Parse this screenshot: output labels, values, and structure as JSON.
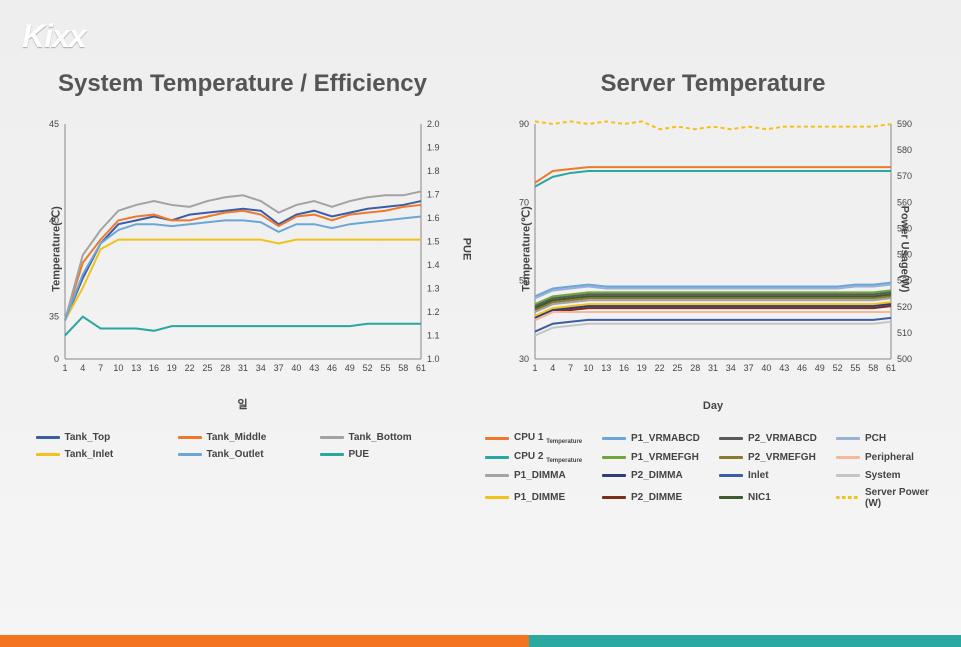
{
  "logo": "Kixx",
  "chart_data": [
    {
      "type": "line",
      "title": "System Temperature / Efficiency",
      "xlabel": "일",
      "ylabel_left": "Temperature(℃)",
      "ylabel_right": "PUE",
      "x": [
        1,
        4,
        7,
        10,
        13,
        16,
        19,
        22,
        25,
        28,
        31,
        34,
        37,
        40,
        43,
        46,
        49,
        52,
        55,
        58,
        61
      ],
      "y_left_scale": {
        "min": 0,
        "max": 45,
        "ticks": [
          0,
          35,
          40,
          45
        ],
        "is_broken": true
      },
      "y_right_scale": {
        "min": 1.0,
        "max": 2.0,
        "ticks": [
          1.0,
          1.1,
          1.2,
          1.3,
          1.4,
          1.5,
          1.6,
          1.7,
          1.8,
          1.9,
          2.0
        ]
      },
      "series": [
        {
          "name": "Tank_Top",
          "color": "#3b5ca8",
          "axis": "left",
          "values": [
            32.0,
            37.0,
            38.8,
            39.8,
            40.0,
            40.2,
            40.0,
            40.3,
            40.4,
            40.5,
            40.6,
            40.5,
            39.8,
            40.3,
            40.5,
            40.2,
            40.4,
            40.6,
            40.7,
            40.8,
            41.0
          ]
        },
        {
          "name": "Tank_Middle",
          "color": "#f0782d",
          "axis": "left",
          "values": [
            32.0,
            37.8,
            39.0,
            40.0,
            40.2,
            40.3,
            40.0,
            40.0,
            40.2,
            40.4,
            40.5,
            40.3,
            39.7,
            40.2,
            40.3,
            40.0,
            40.3,
            40.4,
            40.5,
            40.7,
            40.8
          ]
        },
        {
          "name": "Tank_Bottom",
          "color": "#a3a3a3",
          "axis": "left",
          "values": [
            32.0,
            38.2,
            39.5,
            40.5,
            40.8,
            41.0,
            40.8,
            40.7,
            41.0,
            41.2,
            41.3,
            41.0,
            40.4,
            40.8,
            41.0,
            40.7,
            41.0,
            41.2,
            41.3,
            41.3,
            41.5
          ]
        },
        {
          "name": "Tank_Inlet",
          "color": "#f2c11a",
          "axis": "left",
          "values": [
            32.0,
            36.5,
            38.5,
            39.0,
            39.0,
            39.0,
            39.0,
            39.0,
            39.0,
            39.0,
            39.0,
            39.0,
            38.8,
            39.0,
            39.0,
            39.0,
            39.0,
            39.0,
            39.0,
            39.0,
            39.0
          ]
        },
        {
          "name": "Tank_Outlet",
          "color": "#6aa7d8",
          "axis": "left",
          "values": [
            32.0,
            37.2,
            38.8,
            39.5,
            39.8,
            39.8,
            39.7,
            39.8,
            39.9,
            40.0,
            40.0,
            39.9,
            39.4,
            39.8,
            39.8,
            39.6,
            39.8,
            39.9,
            40.0,
            40.1,
            40.2
          ]
        },
        {
          "name": "PUE",
          "color": "#2aa79f",
          "axis": "right",
          "values": [
            1.1,
            1.18,
            1.13,
            1.13,
            1.13,
            1.12,
            1.14,
            1.14,
            1.14,
            1.14,
            1.14,
            1.14,
            1.14,
            1.14,
            1.14,
            1.14,
            1.14,
            1.15,
            1.15,
            1.15,
            1.15
          ]
        }
      ]
    },
    {
      "type": "line",
      "title": "Server Temperature",
      "xlabel": "Day",
      "ylabel_left": "Temperature(℃)",
      "ylabel_right": "Power Usage(W)",
      "x": [
        1,
        4,
        7,
        10,
        13,
        16,
        19,
        22,
        25,
        28,
        31,
        34,
        37,
        40,
        43,
        46,
        49,
        52,
        55,
        58,
        61
      ],
      "y_left_scale": {
        "min": 30,
        "max": 90,
        "ticks": [
          30,
          50,
          70,
          90
        ]
      },
      "y_right_scale": {
        "min": 500,
        "max": 590,
        "ticks": [
          500,
          510,
          520,
          530,
          540,
          550,
          560,
          570,
          580,
          590
        ]
      },
      "series": [
        {
          "name": "CPU 1 Temperature",
          "color": "#f0782d",
          "axis": "left",
          "values": [
            75.0,
            78.0,
            78.5,
            79.0,
            79.0,
            79.0,
            79.0,
            79.0,
            79.0,
            79.0,
            79.0,
            79.0,
            79.0,
            79.0,
            79.0,
            79.0,
            79.0,
            79.0,
            79.0,
            79.0,
            79.0
          ]
        },
        {
          "name": "CPU 2 Temperature",
          "color": "#2aa79f",
          "axis": "left",
          "values": [
            74.0,
            76.5,
            77.5,
            78.0,
            78.0,
            78.0,
            78.0,
            78.0,
            78.0,
            78.0,
            78.0,
            78.0,
            78.0,
            78.0,
            78.0,
            78.0,
            78.0,
            78.0,
            78.0,
            78.0,
            78.0
          ]
        },
        {
          "name": "P1_VRMABCD",
          "color": "#6aa7d8",
          "axis": "left",
          "values": [
            46.0,
            48.0,
            48.5,
            49.0,
            48.5,
            48.5,
            48.5,
            48.5,
            48.5,
            48.5,
            48.5,
            48.5,
            48.5,
            48.5,
            48.5,
            48.5,
            48.5,
            48.5,
            49.0,
            49.0,
            49.5
          ]
        },
        {
          "name": "P1_VRMEFGH",
          "color": "#6ea83b",
          "axis": "left",
          "values": [
            44.0,
            46.0,
            46.5,
            47.0,
            47.0,
            47.0,
            47.0,
            47.0,
            47.0,
            47.0,
            47.0,
            47.0,
            47.0,
            47.0,
            47.0,
            47.0,
            47.0,
            47.0,
            47.0,
            47.0,
            47.5
          ]
        },
        {
          "name": "P2_VRMABCD",
          "color": "#5a5a5a",
          "axis": "left",
          "values": [
            43.5,
            45.5,
            46.0,
            46.5,
            46.5,
            46.5,
            46.5,
            46.5,
            46.5,
            46.5,
            46.5,
            46.5,
            46.5,
            46.5,
            46.5,
            46.5,
            46.5,
            46.5,
            46.5,
            46.5,
            47.0
          ]
        },
        {
          "name": "P2_VRMEFGH",
          "color": "#8a7a2d",
          "axis": "left",
          "values": [
            42.5,
            44.5,
            45.0,
            45.5,
            45.5,
            45.5,
            45.5,
            45.5,
            45.5,
            45.5,
            45.5,
            45.5,
            45.5,
            45.5,
            45.5,
            45.5,
            45.5,
            45.5,
            45.5,
            45.5,
            46.0
          ]
        },
        {
          "name": "P1_DIMMA",
          "color": "#a3a3a3",
          "axis": "left",
          "values": [
            42.0,
            44.0,
            44.5,
            45.0,
            45.0,
            45.0,
            45.0,
            45.0,
            45.0,
            45.0,
            45.0,
            45.0,
            45.0,
            45.0,
            45.0,
            45.0,
            45.0,
            45.0,
            45.0,
            45.0,
            45.5
          ]
        },
        {
          "name": "P1_DIMME",
          "color": "#f2c11a",
          "axis": "left",
          "values": [
            41.0,
            43.0,
            43.5,
            44.0,
            44.0,
            44.0,
            44.0,
            44.0,
            44.0,
            44.0,
            44.0,
            44.0,
            44.0,
            44.0,
            44.0,
            44.0,
            44.0,
            44.0,
            44.0,
            44.0,
            44.5
          ]
        },
        {
          "name": "P2_DIMMA",
          "color": "#2e3d7a",
          "axis": "left",
          "values": [
            40.5,
            42.5,
            43.0,
            43.5,
            43.5,
            43.5,
            43.5,
            43.5,
            43.5,
            43.5,
            43.5,
            43.5,
            43.5,
            43.5,
            43.5,
            43.5,
            43.5,
            43.5,
            43.5,
            43.5,
            44.0
          ]
        },
        {
          "name": "P2_DIMME",
          "color": "#7a2d1d",
          "axis": "left",
          "values": [
            40.0,
            42.0,
            42.5,
            43.0,
            43.0,
            43.0,
            43.0,
            43.0,
            43.0,
            43.0,
            43.0,
            43.0,
            43.0,
            43.0,
            43.0,
            43.0,
            43.0,
            43.0,
            43.0,
            43.0,
            43.5
          ]
        },
        {
          "name": "PCH",
          "color": "#9bb0d8",
          "axis": "left",
          "values": [
            45.5,
            47.5,
            48.0,
            48.5,
            48.0,
            48.0,
            48.0,
            48.0,
            48.0,
            48.0,
            48.0,
            48.0,
            48.0,
            48.0,
            48.0,
            48.0,
            48.0,
            48.0,
            48.5,
            48.5,
            49.0
          ]
        },
        {
          "name": "Peripheral",
          "color": "#f5b99a",
          "axis": "left",
          "values": [
            40.0,
            42.0,
            42.0,
            42.0,
            42.0,
            42.0,
            42.0,
            42.0,
            42.0,
            42.0,
            42.0,
            42.0,
            42.0,
            42.0,
            42.0,
            42.0,
            42.0,
            42.0,
            42.0,
            42.0,
            42.0
          ]
        },
        {
          "name": "Inlet",
          "color": "#3b5ca8",
          "axis": "left",
          "values": [
            37.0,
            39.0,
            39.5,
            40.0,
            40.0,
            40.0,
            40.0,
            40.0,
            40.0,
            40.0,
            40.0,
            40.0,
            40.0,
            40.0,
            40.0,
            40.0,
            40.0,
            40.0,
            40.0,
            40.0,
            40.5
          ]
        },
        {
          "name": "NIC1",
          "color": "#3f5a2d",
          "axis": "left",
          "values": [
            43.0,
            45.0,
            45.5,
            46.0,
            46.0,
            46.0,
            46.0,
            46.0,
            46.0,
            46.0,
            46.0,
            46.0,
            46.0,
            46.0,
            46.0,
            46.0,
            46.0,
            46.0,
            46.0,
            46.0,
            46.5
          ]
        },
        {
          "name": "System",
          "color": "#c5c5c5",
          "axis": "left",
          "values": [
            36.0,
            38.0,
            38.5,
            39.0,
            39.0,
            39.0,
            39.0,
            39.0,
            39.0,
            39.0,
            39.0,
            39.0,
            39.0,
            39.0,
            39.0,
            39.0,
            39.0,
            39.0,
            39.0,
            39.0,
            39.5
          ]
        },
        {
          "name": "Server Power (W)",
          "color": "#f2c11a",
          "axis": "right",
          "dashed": true,
          "values": [
            591,
            590,
            591,
            590,
            591,
            590,
            591,
            588,
            589,
            588,
            589,
            588,
            589,
            588,
            589,
            589,
            589,
            589,
            589,
            589,
            590
          ]
        }
      ]
    }
  ],
  "legend1": [
    {
      "key": "Tank_Top",
      "color": "#3b5ca8"
    },
    {
      "key": "Tank_Middle",
      "color": "#f0782d"
    },
    {
      "key": "Tank_Bottom",
      "color": "#a3a3a3"
    },
    {
      "key": "Tank_Inlet",
      "color": "#f2c11a"
    },
    {
      "key": "Tank_Outlet",
      "color": "#6aa7d8"
    },
    {
      "key": "PUE",
      "color": "#2aa79f"
    }
  ],
  "legend2": [
    {
      "key": "CPU 1 Temperature",
      "color": "#f0782d"
    },
    {
      "key": "P1_VRMABCD",
      "color": "#6aa7d8"
    },
    {
      "key": "P2_VRMABCD",
      "color": "#5a5a5a"
    },
    {
      "key": "PCH",
      "color": "#9bb0d8"
    },
    {
      "key": "CPU 2 Temperature",
      "color": "#2aa79f"
    },
    {
      "key": "P1_VRMEFGH",
      "color": "#6ea83b"
    },
    {
      "key": "P2_VRMEFGH",
      "color": "#8a7a2d"
    },
    {
      "key": "Peripheral",
      "color": "#f5b99a"
    },
    {
      "key": "P1_DIMMA",
      "color": "#a3a3a3"
    },
    {
      "key": "P2_DIMMA",
      "color": "#2e3d7a"
    },
    {
      "key": "Inlet",
      "color": "#3b5ca8"
    },
    {
      "key": "System",
      "color": "#c5c5c5"
    },
    {
      "key": "P1_DIMME",
      "color": "#f2c11a"
    },
    {
      "key": "P2_DIMME",
      "color": "#7a2d1d"
    },
    {
      "key": "NIC1",
      "color": "#3f5a2d"
    },
    {
      "key": "Server Power (W)",
      "color": "#f2c11a",
      "dashed": true
    }
  ]
}
